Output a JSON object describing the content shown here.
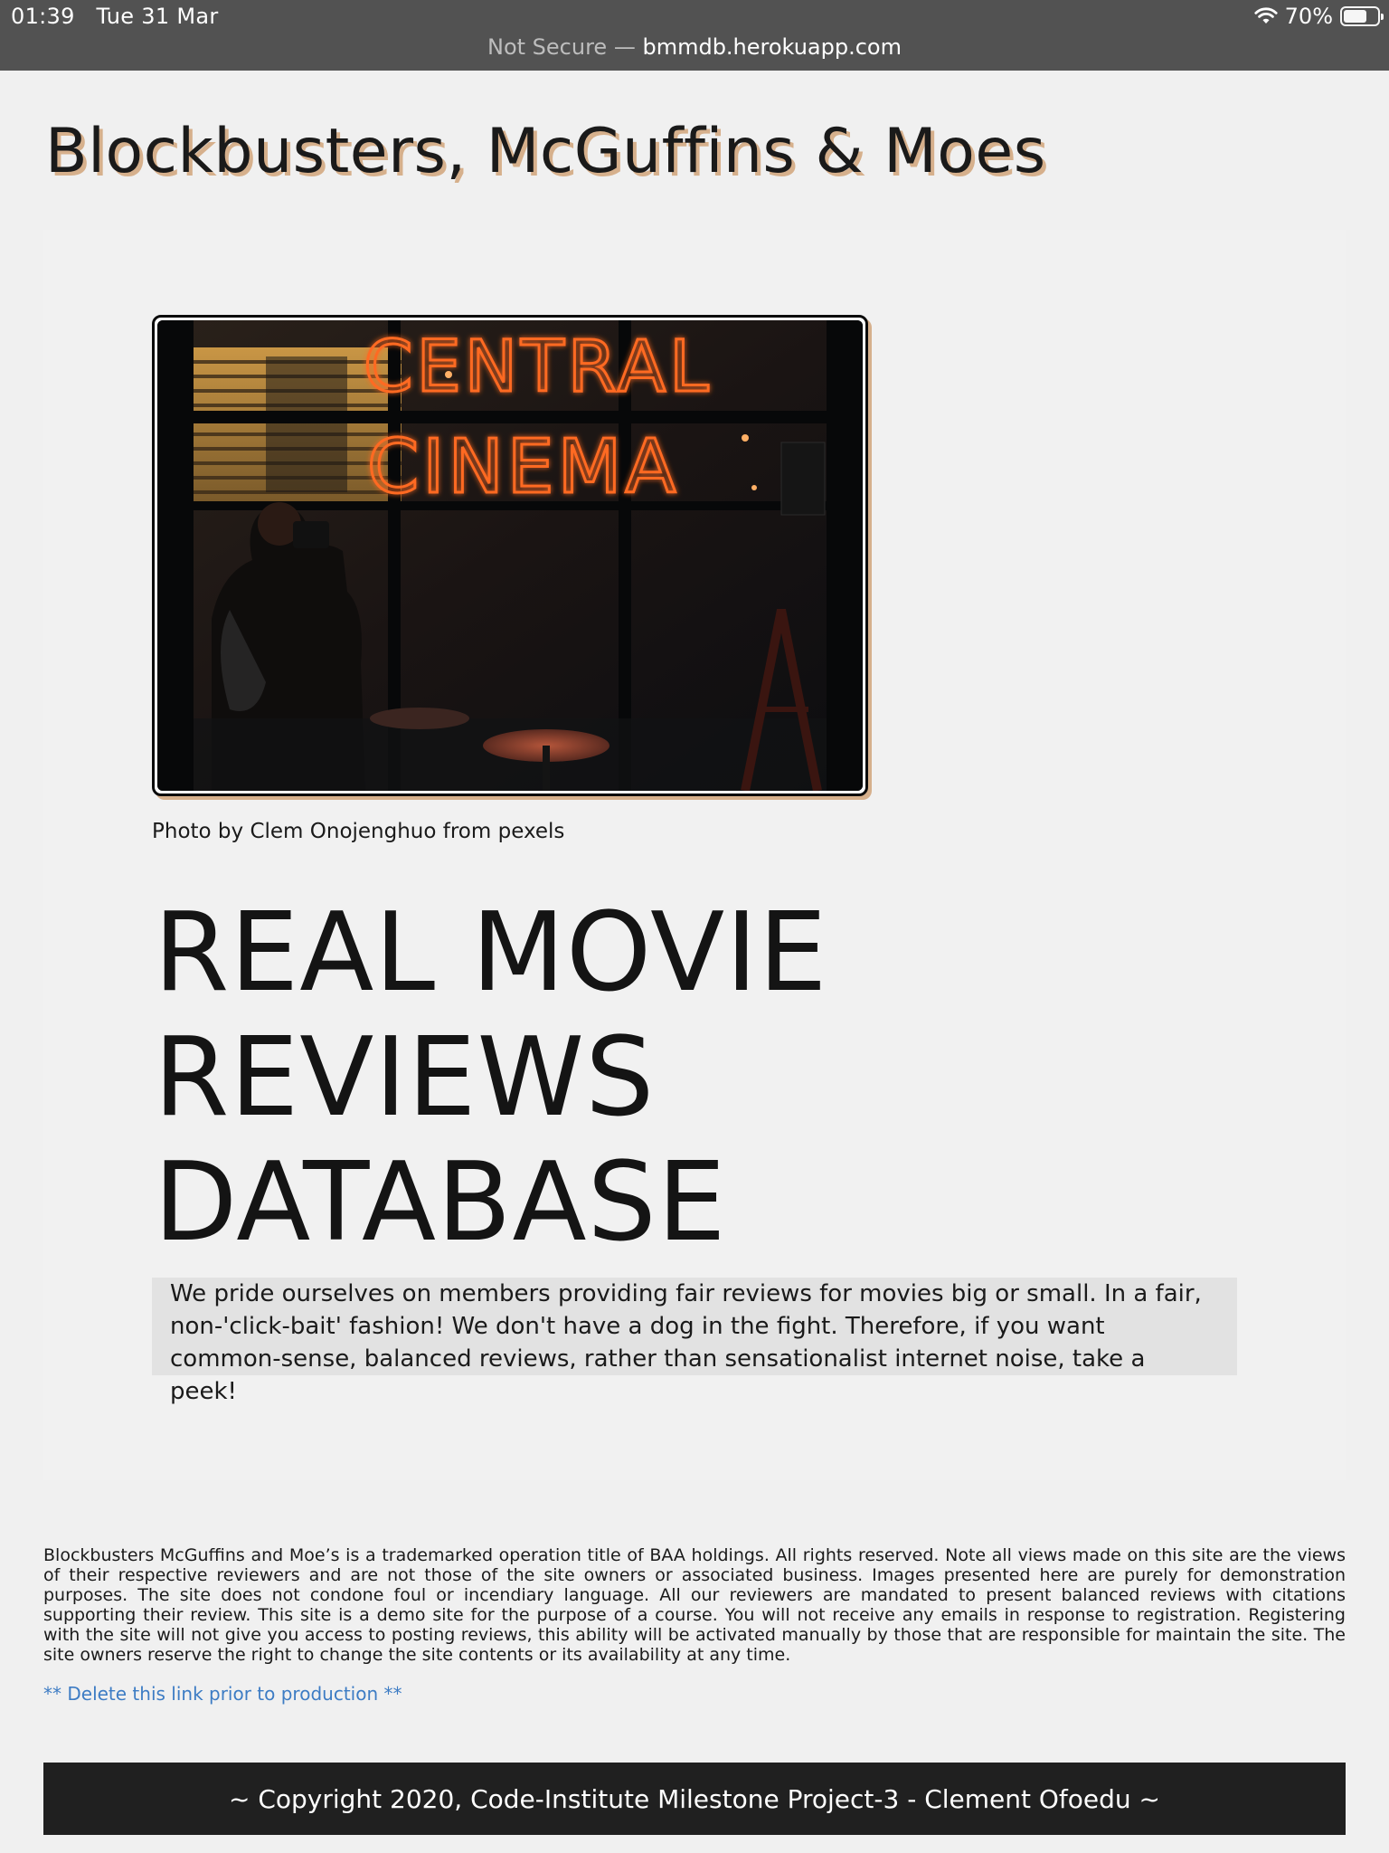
{
  "status_bar": {
    "time": "01:39",
    "date": "Tue 31 Mar",
    "battery": "70%",
    "battery_level": 0.7,
    "wifi_icon": "wifi-icon",
    "battery_icon": "battery-icon"
  },
  "address_bar": {
    "security": "Not Secure",
    "separator": "—",
    "domain": "bmmdb.herokuapp.com"
  },
  "site": {
    "title": "Blockbusters, McGuffins & Moes"
  },
  "hero": {
    "image_alt": "Central Cinema neon sign",
    "sign_line1": "CENTRAL",
    "sign_line2": "CINEMA",
    "photo_credit": "Photo by Clem Onojenghuo from pexels",
    "heading_lines": [
      "REAL MOVIE",
      "REVIEWS",
      "DATABASE"
    ],
    "intro": "We pride ourselves on members providing fair reviews for movies big or small. In a fair, non-'click-bait' fashion! We don't have a dog in the fight. Therefore, if you want common-sense, balanced reviews, rather than sensationalist internet noise, take a peek!"
  },
  "disclaimer": "Blockbusters McGuffins and Moe’s is a trademarked operation title of BAA holdings. All rights reserved. Note all views made on this site are the views of their respective reviewers and are not those of the site owners or associated business. Images presented here are purely for demonstration purposes. The site does not condone foul or incendiary language. All our reviewers are mandated to present balanced reviews with citations supporting their review. This site is a demo site for the purpose of a course. You will not receive any emails in response to registration. Registering with the site will not give you access to posting reviews, this ability will be activated manually by those that are responsible for maintain the site. The site owners reserve the right to change the site contents or its availability at any time.",
  "dev_link": "** Delete this link prior to production **",
  "footer": {
    "copyright": "~ Copyright 2020, Code-Institute Milestone Project-3 - Clement Ofoedu ~"
  },
  "colors": {
    "status_bar_bg": "#525252",
    "page_bg": "#f0f0f0",
    "title_shadow": "#d6b08c",
    "intro_bg": "#e2e2e2",
    "link": "#3d7cc4",
    "footer_bg": "#202020",
    "neon": "#ff5a1f"
  }
}
